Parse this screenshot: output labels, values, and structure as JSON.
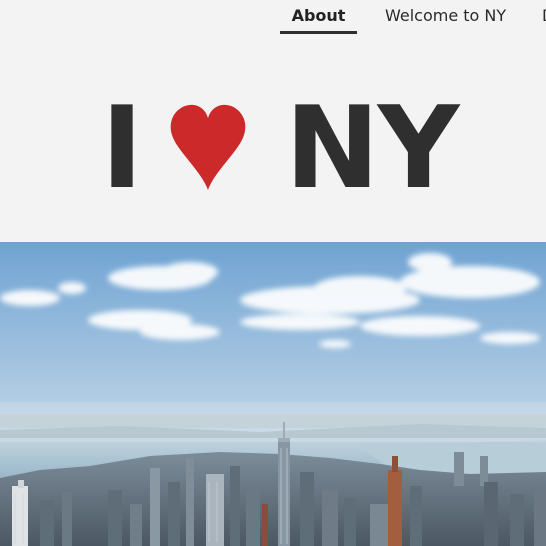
{
  "nav": {
    "items": [
      {
        "label": "About",
        "active": true
      },
      {
        "label": "Welcome to NY",
        "active": false
      },
      {
        "label": "D",
        "active": false
      }
    ]
  },
  "logo": {
    "word_i": "I",
    "word_ny": "NY",
    "heart_icon": "heart-icon",
    "heart_color": "#cc2a2a",
    "text_color": "#2f2f2f"
  },
  "hero": {
    "icon": "city-skyline-photo"
  },
  "colors": {
    "background": "#f3f3f3",
    "nav_underline": "#2e2e2e"
  }
}
